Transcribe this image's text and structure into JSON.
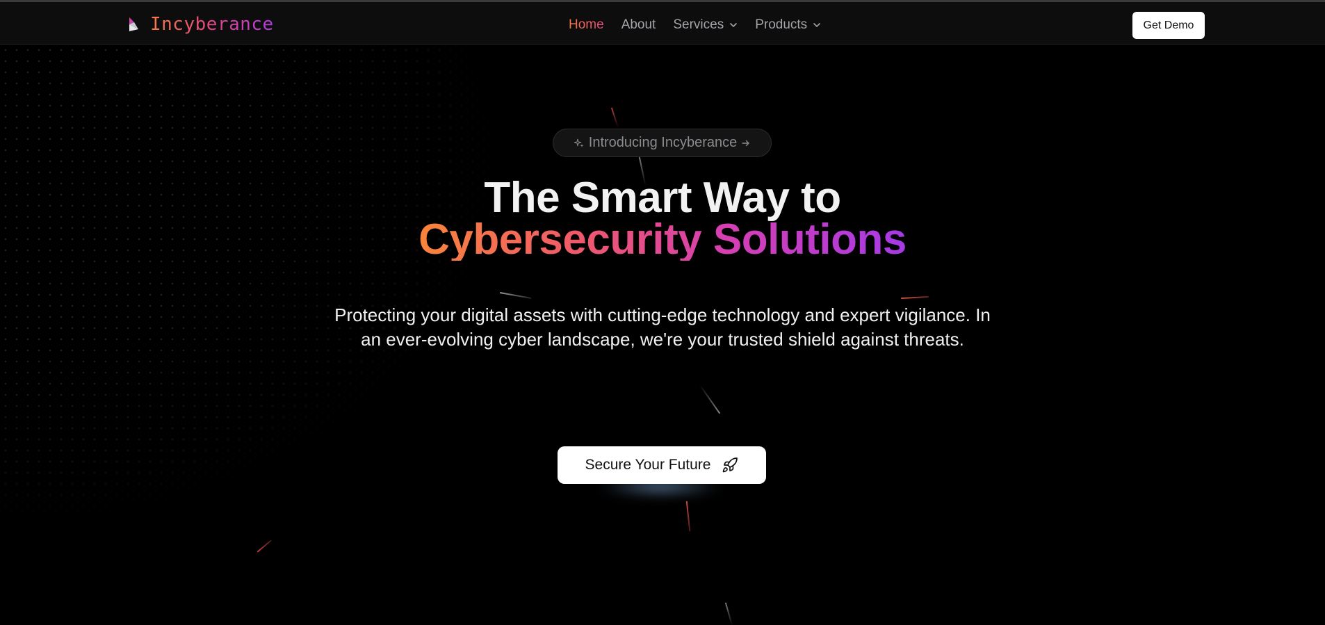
{
  "brand": {
    "name": "Incyberance",
    "logo_icon": "incyberance-logo-icon"
  },
  "nav": {
    "items": [
      {
        "label": "Home",
        "active": true
      },
      {
        "label": "About"
      },
      {
        "label": "Services",
        "icon": "chevron-down-icon"
      },
      {
        "label": "Products",
        "icon": "chevron-down-icon"
      }
    ],
    "cta_label": "Get Demo"
  },
  "hero": {
    "badge": {
      "icon": "sparkle-icon",
      "label": "Introducing Incyberance",
      "arrow_icon": "arrow-right-icon"
    },
    "headline_line1": "The Smart Way to",
    "headline_line2": "Cybersecurity Solutions",
    "subtitle": "Protecting your digital assets with cutting-edge technology and expert vigilance. In an ever-evolving cyber landscape, we're your trusted shield against threats.",
    "cta_label": "Secure Your Future",
    "cta_icon": "rocket-icon"
  },
  "colors": {
    "background": "#000000",
    "gradient_start": "#f9843a",
    "gradient_mid": "#d63fb0",
    "gradient_end": "#a63ae6",
    "nav_text": "#a3a3a8"
  }
}
